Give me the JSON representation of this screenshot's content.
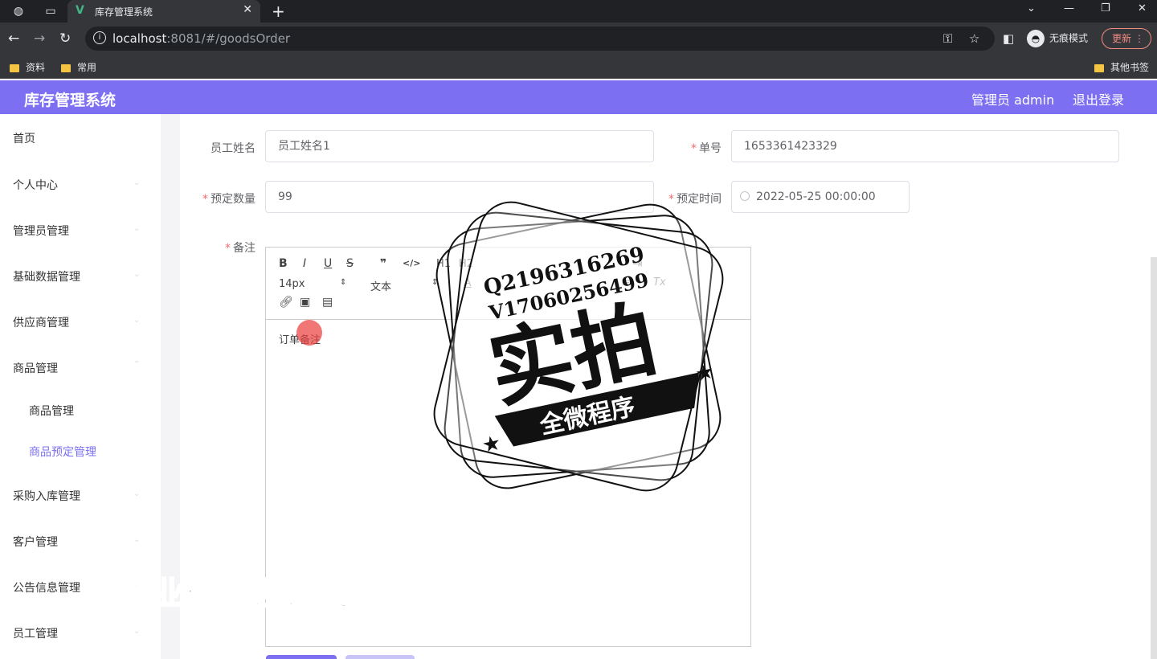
{
  "browser": {
    "tab_title": "库存管理系统",
    "url_host": "localhost",
    "url_path": ":8081/#/goodsOrder",
    "incognito_label": "无痕模式",
    "update_label": "更新",
    "bookmarks": [
      "资料",
      "常用"
    ],
    "other_bookmarks": "其他书签"
  },
  "app": {
    "title": "库存管理系统",
    "user": "管理员 admin",
    "logout": "退出登录"
  },
  "sidebar": {
    "items": [
      {
        "label": "首页"
      },
      {
        "label": "个人中心"
      },
      {
        "label": "管理员管理"
      },
      {
        "label": "基础数据管理"
      },
      {
        "label": "供应商管理"
      },
      {
        "label": "商品管理"
      },
      {
        "label": "商品管理"
      },
      {
        "label": "商品预定管理"
      },
      {
        "label": "采购入库管理"
      },
      {
        "label": "客户管理"
      },
      {
        "label": "公告信息管理"
      },
      {
        "label": "员工管理"
      }
    ]
  },
  "form": {
    "employee_label": "员工姓名",
    "employee_value": "员工姓名1",
    "order_no_label": "单号",
    "order_no_value": "1653361423329",
    "quantity_label": "预定数量",
    "quantity_value": "99",
    "time_label": "预定时间",
    "time_value": "2022-05-25 00:00:00",
    "remark_label": "备注",
    "remark_value": "订单备注",
    "required_mark": "*"
  },
  "editor": {
    "font_size": "14px",
    "font_family": "文本",
    "bold": "B",
    "italic": "I",
    "underline": "U",
    "strike": "S",
    "quote": "❞",
    "code": "</>",
    "h1": "H1",
    "h2": "H2",
    "clear": "Tx"
  },
  "watermarks": {
    "stamp_contact_q": "Q2196316269",
    "stamp_contact_v": "V17060256499",
    "stamp_main": "实拍",
    "stamp_ribbon": "全微程序",
    "bottom_text": "专业毕业设计代做"
  }
}
